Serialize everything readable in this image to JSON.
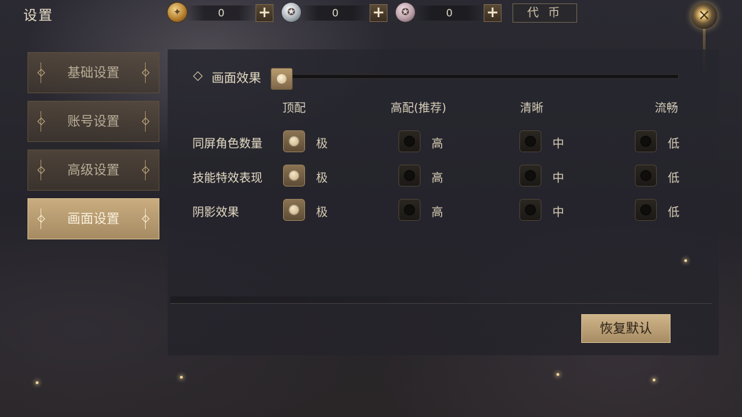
{
  "header": {
    "title": "设置",
    "currencies": [
      {
        "icon": "gold-coin-icon",
        "value": "0",
        "add_label": "+"
      },
      {
        "icon": "silver-coin-icon",
        "value": "0",
        "add_label": "+"
      },
      {
        "icon": "rose-coin-icon",
        "value": "0",
        "add_label": "+"
      }
    ],
    "token_label": "代 币",
    "close_icon": "×"
  },
  "sidebar": {
    "items": [
      {
        "label": "基础设置",
        "active": false
      },
      {
        "label": "账号设置",
        "active": false
      },
      {
        "label": "高级设置",
        "active": false
      },
      {
        "label": "画面设置",
        "active": true
      }
    ]
  },
  "graphics": {
    "section_title": "画面效果",
    "slider_value": 0,
    "columns": [
      "顶配",
      "高配(推荐)",
      "清晰",
      "流畅"
    ],
    "rows": [
      {
        "label": "同屏角色数量",
        "options": [
          "极",
          "高",
          "中",
          "低"
        ],
        "selected": 0
      },
      {
        "label": "技能特效表现",
        "options": [
          "极",
          "高",
          "中",
          "低"
        ],
        "selected": 0
      },
      {
        "label": "阴影效果",
        "options": [
          "极",
          "高",
          "中",
          "低"
        ],
        "selected": 0
      }
    ],
    "reset_label": "恢复默认"
  },
  "colors": {
    "accent": "#c9ad80",
    "panel": "#26262e"
  }
}
